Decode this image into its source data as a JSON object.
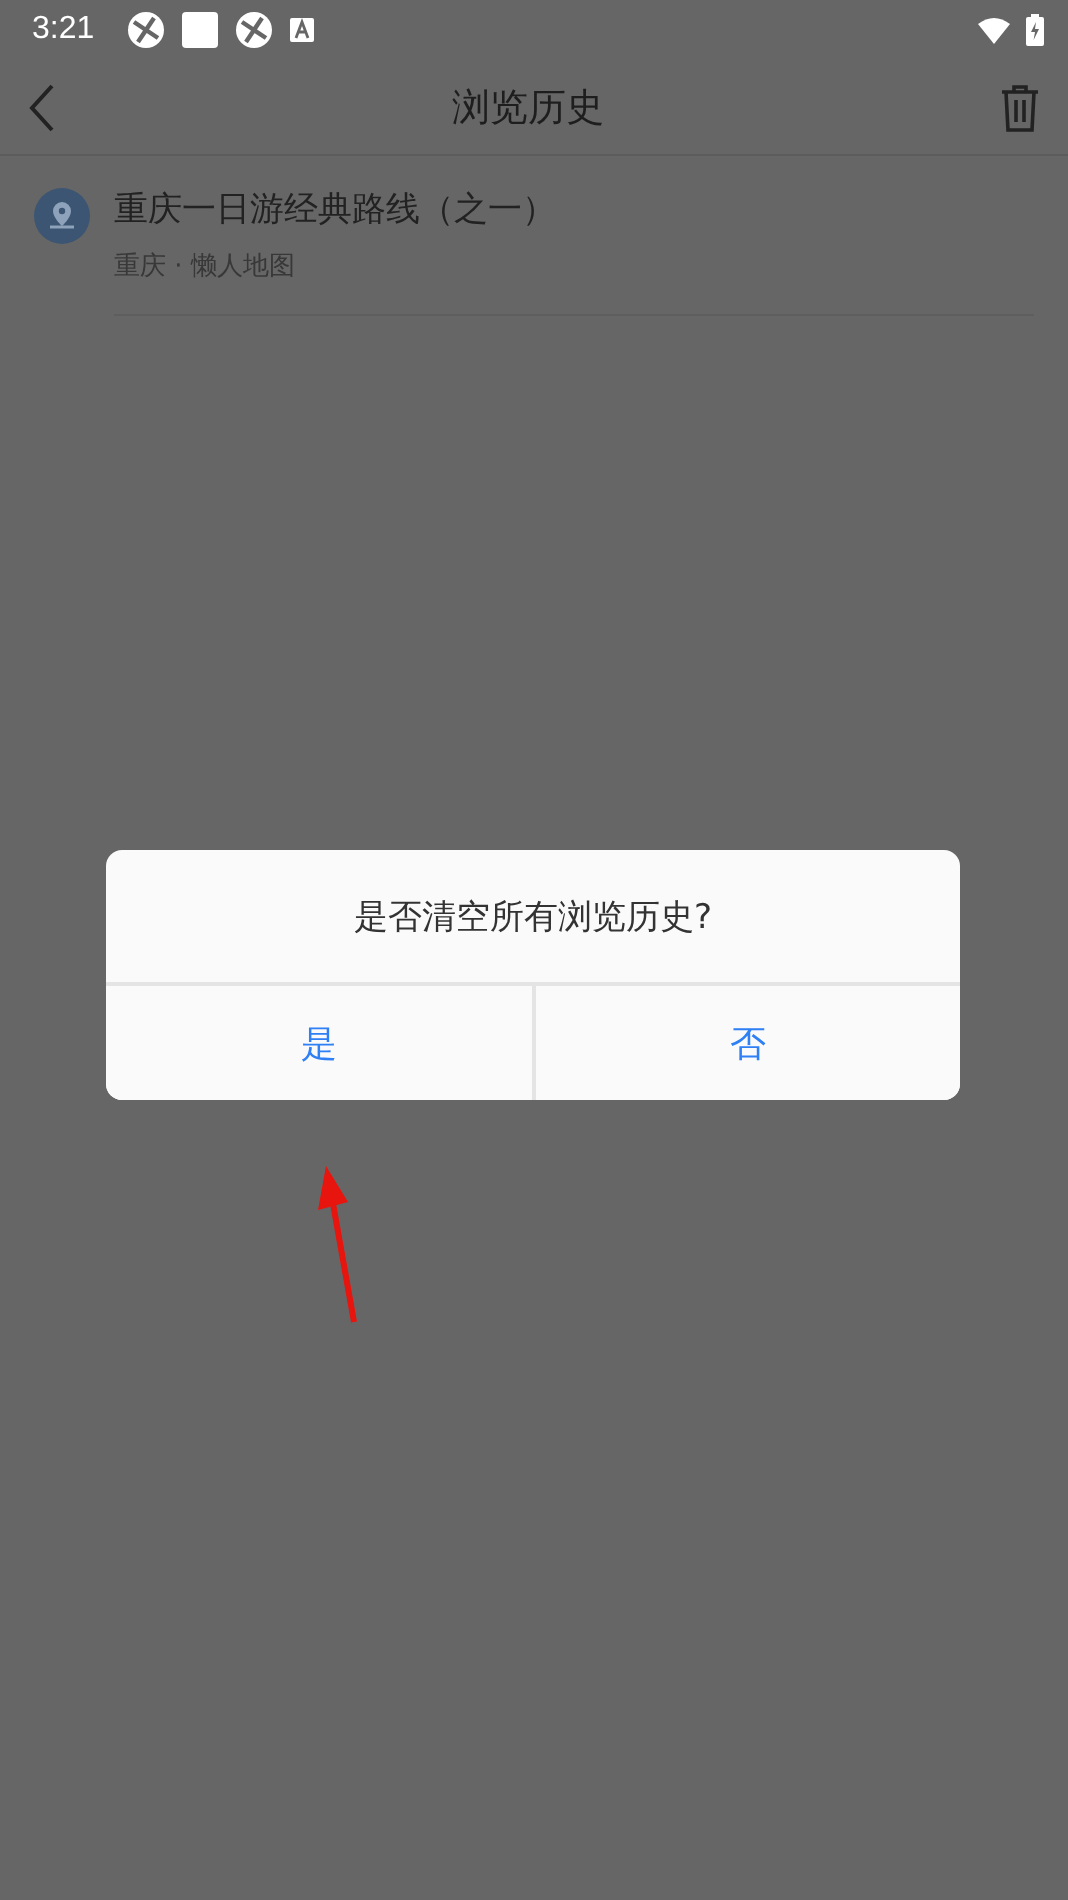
{
  "status_bar": {
    "time": "3:21"
  },
  "header": {
    "title": "浏览历史"
  },
  "history": [
    {
      "title": "重庆一日游经典路线（之一）",
      "subtitle": "重庆 · 懒人地图"
    }
  ],
  "dialog": {
    "message": "是否清空所有浏览历史?",
    "buttons": [
      "是",
      "否"
    ]
  }
}
